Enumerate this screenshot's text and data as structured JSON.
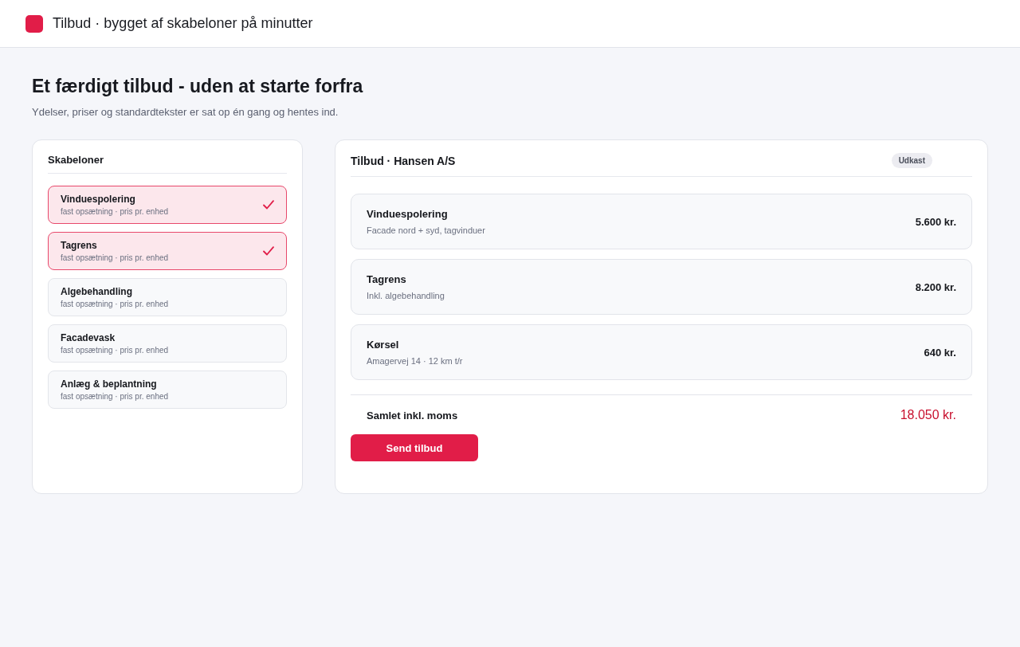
{
  "header": {
    "title": "Tilbud · bygget af skabeloner på minutter"
  },
  "intro": {
    "heading": "Et færdigt tilbud - uden at starte forfra",
    "text": "Ydelser, priser og standardtekster er sat op én gang og hentes ind."
  },
  "templates": {
    "title": "Skabeloner",
    "items": [
      {
        "name": "Vinduespolering",
        "detail": "fast opsætning · pris pr. enhed",
        "selected": true
      },
      {
        "name": "Tagrens",
        "detail": "fast opsætning · pris pr. enhed",
        "selected": true
      },
      {
        "name": "Algebehandling",
        "detail": "fast opsætning · pris pr. enhed",
        "selected": false
      },
      {
        "name": "Facadevask",
        "detail": "fast opsætning · pris pr. enhed",
        "selected": false
      },
      {
        "name": "Anlæg & beplantning",
        "detail": "fast opsætning · pris pr. enhed",
        "selected": false
      }
    ]
  },
  "quote": {
    "title": "Tilbud · Hansen A/S",
    "status": "Udkast",
    "lines": [
      {
        "name": "Vinduespolering",
        "detail": "Facade nord + syd, tagvinduer",
        "amount": "5.600 kr."
      },
      {
        "name": "Tagrens",
        "detail": "Inkl. algebehandling",
        "amount": "8.200 kr."
      },
      {
        "name": "Kørsel",
        "detail": "Amagervej 14 · 12 km t/r",
        "amount": "640 kr."
      }
    ],
    "total": {
      "label": "Samlet inkl. moms",
      "amount": "18.050 kr."
    },
    "send_button": "Send tilbud"
  }
}
